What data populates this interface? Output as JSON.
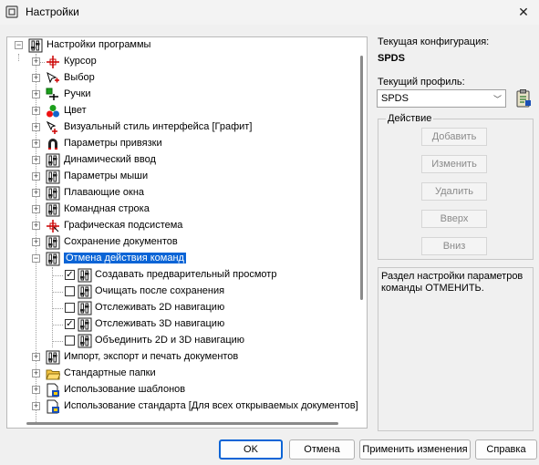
{
  "window": {
    "title": "Настройки",
    "close_glyph": "✕"
  },
  "tree": {
    "root": "Настройки программы",
    "items": [
      "Курсор",
      "Выбор",
      "Ручки",
      "Цвет",
      "Визуальный стиль интерфейса [Графит]",
      "Параметры привязки",
      "Динамический ввод",
      "Параметры мыши",
      "Плавающие окна",
      "Командная строка",
      "Графическая подсистема",
      "Сохранение документов",
      "Отмена действия команд"
    ],
    "undo_children": [
      {
        "label": "Создавать предварительный просмотр",
        "checked": true
      },
      {
        "label": "Очищать после сохранения",
        "checked": false
      },
      {
        "label": "Отслеживать 2D навигацию",
        "checked": false
      },
      {
        "label": "Отслеживать 3D навигацию",
        "checked": true
      },
      {
        "label": "Объединить 2D и 3D навигацию",
        "checked": false
      }
    ],
    "items_after": [
      "Импорт, экспорт и печать документов",
      "Стандартные папки",
      "Использование шаблонов",
      "Использование стандарта [Для всех открываемых документов]"
    ],
    "check_glyph": "✓",
    "expand_glyph": "+",
    "collapse_glyph": "−"
  },
  "config": {
    "current_config_label": "Текущая конфигурация:",
    "current_config_value": "SPDS",
    "current_profile_label": "Текущий профиль:",
    "profile_value": "SPDS",
    "dropdown_glyph": "﹀"
  },
  "actions": {
    "legend": "Действие",
    "add": "Добавить",
    "change": "Изменить",
    "delete": "Удалить",
    "up": "Вверх",
    "down": "Вниз"
  },
  "description": "Раздел настройки параметров команды ОТМЕНИТЬ.",
  "buttons": {
    "ok": "OK",
    "cancel": "Отмена",
    "apply": "Применить изменения",
    "help": "Справка"
  },
  "colors": {
    "selection": "#0a64d6",
    "background": "#f0f0f0"
  }
}
